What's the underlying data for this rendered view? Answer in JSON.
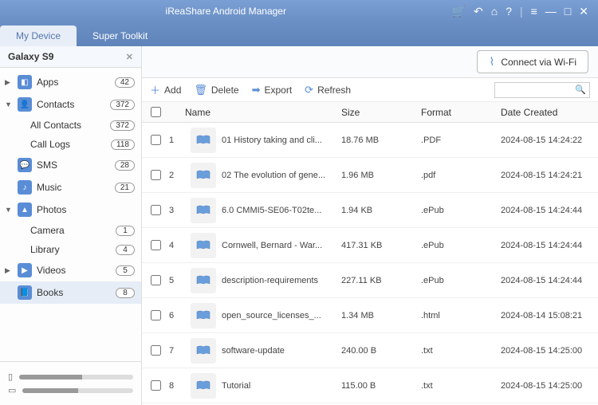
{
  "header": {
    "title": "iReaShare Android Manager"
  },
  "tabs": {
    "device": "My Device",
    "toolkit": "Super Toolkit"
  },
  "device": {
    "name": "Galaxy S9"
  },
  "sidebar": {
    "items": [
      {
        "label": "Apps",
        "badge": "42"
      },
      {
        "label": "Contacts",
        "badge": "372"
      },
      {
        "label": "All Contacts",
        "badge": "372"
      },
      {
        "label": "Call Logs",
        "badge": "118"
      },
      {
        "label": "SMS",
        "badge": "28"
      },
      {
        "label": "Music",
        "badge": "21"
      },
      {
        "label": "Photos",
        "badge": ""
      },
      {
        "label": "Camera",
        "badge": "1"
      },
      {
        "label": "Library",
        "badge": "4"
      },
      {
        "label": "Videos",
        "badge": "5"
      },
      {
        "label": "Books",
        "badge": "8"
      }
    ]
  },
  "topbar": {
    "wifi": "Connect via Wi-Fi"
  },
  "toolbar": {
    "add": "Add",
    "delete": "Delete",
    "export": "Export",
    "refresh": "Refresh"
  },
  "columns": {
    "name": "Name",
    "size": "Size",
    "format": "Format",
    "date": "Date Created"
  },
  "rows": [
    {
      "n": "1",
      "name": "01 History taking and cli...",
      "size": "18.76 MB",
      "format": ".PDF",
      "date": "2024-08-15 14:24:22"
    },
    {
      "n": "2",
      "name": "02 The evolution of gene...",
      "size": "1.96 MB",
      "format": ".pdf",
      "date": "2024-08-15 14:24:21"
    },
    {
      "n": "3",
      "name": "6.0 CMMI5-SE06-T02te...",
      "size": "1.94 KB",
      "format": ".ePub",
      "date": "2024-08-15 14:24:44"
    },
    {
      "n": "4",
      "name": "Cornwell, Bernard - War...",
      "size": "417.31 KB",
      "format": ".ePub",
      "date": "2024-08-15 14:24:44"
    },
    {
      "n": "5",
      "name": "description-requirements",
      "size": "227.11 KB",
      "format": ".ePub",
      "date": "2024-08-15 14:24:44"
    },
    {
      "n": "6",
      "name": "open_source_licenses_...",
      "size": "1.34 MB",
      "format": ".html",
      "date": "2024-08-14 15:08:21"
    },
    {
      "n": "7",
      "name": "software-update",
      "size": "240.00 B",
      "format": ".txt",
      "date": "2024-08-15 14:25:00"
    },
    {
      "n": "8",
      "name": "Tutorial",
      "size": "115.00 B",
      "format": ".txt",
      "date": "2024-08-15 14:25:00"
    }
  ]
}
